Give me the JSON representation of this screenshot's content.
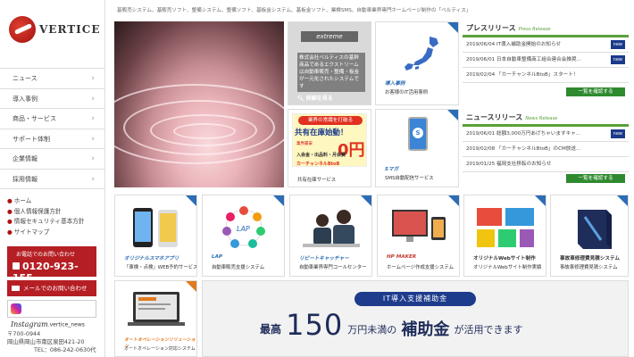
{
  "logo": {
    "word": "VERTICE"
  },
  "tagline": "基販売システム、基販売ソフト、整備システム、整備ソフト、基板金システム、基板金ソフト、業検SMS、自動車業界専門ホームページ制作の「ベルティス」",
  "nav": {
    "items": [
      {
        "label": "ニュース"
      },
      {
        "label": "導入事例"
      },
      {
        "label": "商品・サービス"
      },
      {
        "label": "サポート体制"
      },
      {
        "label": "企業情報"
      },
      {
        "label": "採用情報"
      }
    ],
    "chevron": "›"
  },
  "sublinks": [
    {
      "label": "ホーム"
    },
    {
      "label": "個人情報保護方針"
    },
    {
      "label": "情報セキュリティ基本方針"
    },
    {
      "label": "サイトマップ"
    }
  ],
  "contact": {
    "phone_caption": "お電話でのお問い合わせ",
    "phone_number": "0120-923-155",
    "mail_label": "メールでのお問い合わせ",
    "insta_word": "Instagram",
    "insta_handle": ".vertice_news"
  },
  "address": {
    "zip": "〒700-0944",
    "line1": "岡山県岡山市南区泉田421-20",
    "tel": "TEL：086-242-0630代"
  },
  "tiles": {
    "extreme": {
      "label": "extreme",
      "text": "株式会社ベルティスの基幹商品であるエクストリームは自動車販売・整備・板金が一元化されたシステムです",
      "button": "詳細を見る"
    },
    "japan": {
      "cap1": "導入事例",
      "cap2": "お客様のIT活用事例"
    },
    "kyousu": {
      "b1": "業界の常識を打破る",
      "b2": "共有在庫始動！",
      "b3": "業界最安",
      "b4": "0円",
      "b5": "入会金・出品料・月会費",
      "b6": "カーチャンネルBtoB",
      "cap2": "共有在庫サービス"
    },
    "smaga": {
      "icon_text": "S",
      "cap1": "Sマガ",
      "cap2": "SMS自動配信サービス"
    }
  },
  "press": {
    "title": "プレスリリース",
    "subtitle": "Press Release",
    "new_tag": "new",
    "rows": [
      {
        "text": "2019/06/04 IT導入補助金開始のお知らせ",
        "is_new": true
      },
      {
        "text": "2019/06/01 日本自動車整備商工組合連合会推奨...",
        "is_new": true
      },
      {
        "text": "2019/02/04 「カーチャンネルBtoB」スタート！",
        "is_new": false
      }
    ],
    "more": "一覧を確認する"
  },
  "news": {
    "title": "ニュースリリース",
    "subtitle": "News Release",
    "new_tag": "new",
    "rows": [
      {
        "text": "2019/06/01 総額3,000万円あげちゃいますキャ...",
        "is_new": true
      },
      {
        "text": "2019/02/08 「カーチャンネルBtoB」のCM放送...",
        "is_new": false
      },
      {
        "text": "2019/01/25 福岡支社移転のお知らせ",
        "is_new": false
      }
    ],
    "more": "一覧を確認する"
  },
  "products": [
    {
      "cap1": "オリジナルスマホアプリ",
      "cap2": "「車検・点検」WEB予約サービス",
      "corner": "blue"
    },
    {
      "cap1": "LAP",
      "cap2": "自動車販売支援システム",
      "corner": "blue"
    },
    {
      "cap1": "リピートキャッチャー",
      "cap2": "自動車業界専門コールセンター",
      "corner": "blue"
    },
    {
      "cap1": "HP MAKER",
      "cap2": "ホームページ作成支援システム",
      "corner": "blue"
    },
    {
      "cap1": "オリジナルWebサイト制作",
      "cap2": "オリジナルWebサイト制作実績",
      "corner": "blue"
    },
    {
      "cap1": "事故車修理費見積システム",
      "cap2": "事故車修理費見積システム",
      "corner": "blue"
    }
  ],
  "auto_tile": {
    "cap1": "オートオペレーションソリューション",
    "cap2": "オートオペレーション対応システム"
  },
  "hojo": {
    "pill": "IT導入支援補助金",
    "s1": "最高",
    "num": "150",
    "s2": "万円未満の",
    "s3": "補助金",
    "s4": "が活用できます"
  }
}
